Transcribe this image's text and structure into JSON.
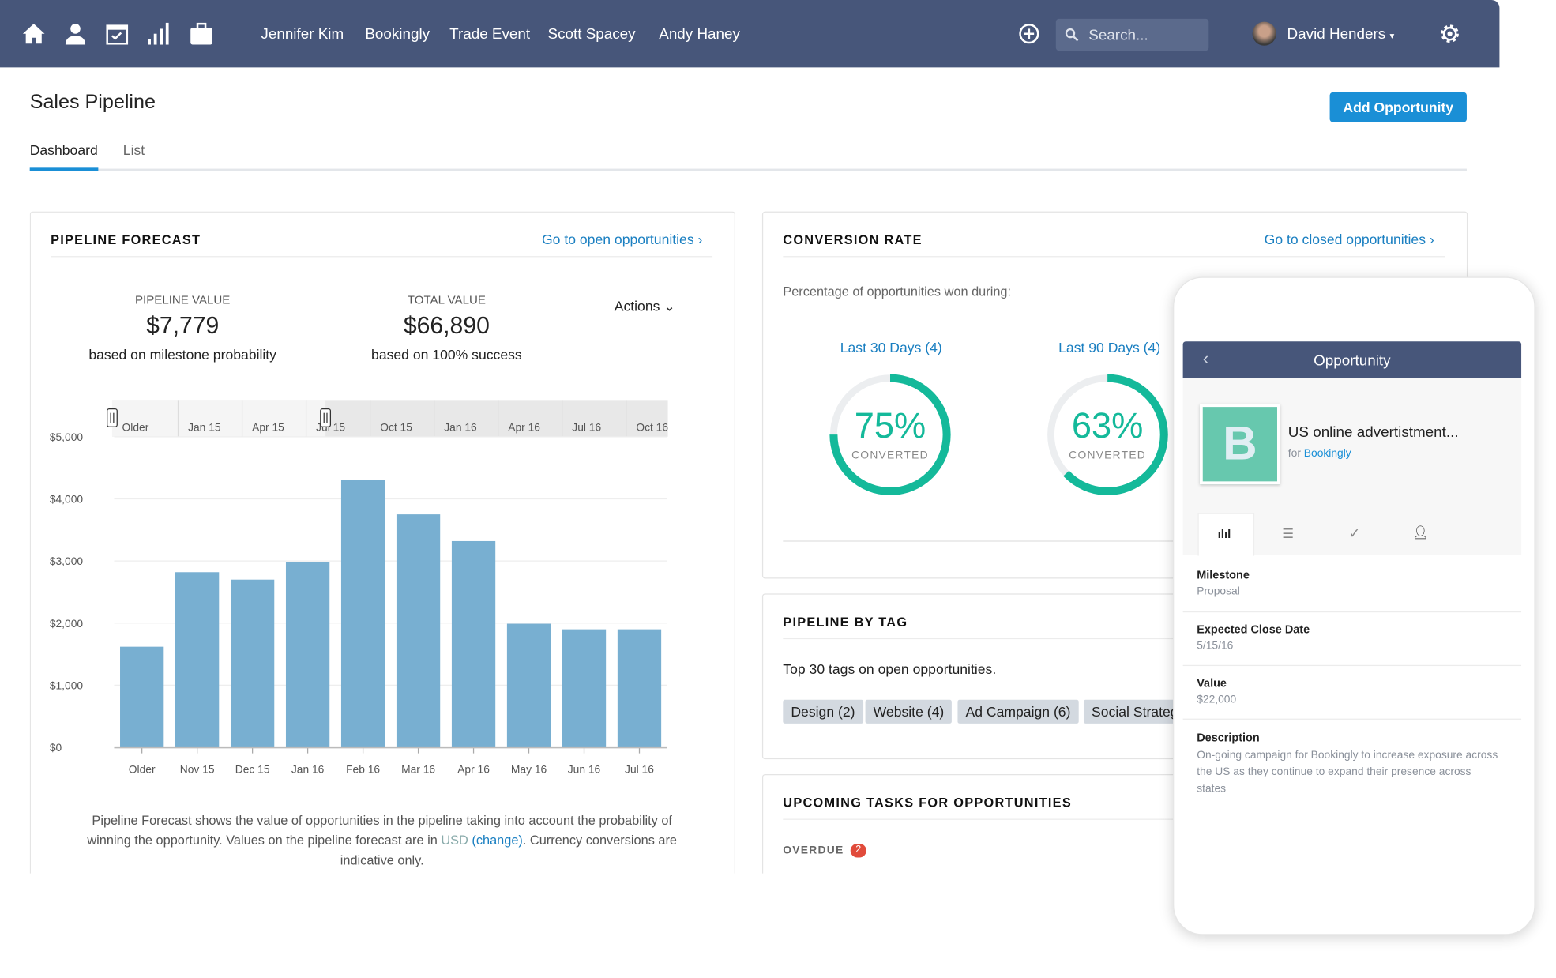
{
  "nav": {
    "icons": [
      "home-icon",
      "user-icon",
      "calendar-icon",
      "bar-chart-icon",
      "briefcase-icon"
    ],
    "links": [
      "Jennifer Kim",
      "Bookingly",
      "Trade Event",
      "Scott Spacey",
      "Andy Haney"
    ],
    "search_placeholder": "Search...",
    "user": "David Henders",
    "color": "#47567a"
  },
  "page": {
    "title": "Sales Pipeline",
    "add_button": "Add Opportunity",
    "tabs": [
      {
        "label": "Dashboard",
        "active": true
      },
      {
        "label": "List",
        "active": false
      }
    ]
  },
  "forecast": {
    "title": "PIPELINE FORECAST",
    "link": "Go to open opportunities ›",
    "pipeline_label": "PIPELINE VALUE",
    "pipeline_value": "$7,779",
    "pipeline_note": "based on milestone probability",
    "total_label": "TOTAL VALUE",
    "total_value": "$66,890",
    "total_note": "based on 100% success",
    "actions": "Actions",
    "navigator_labels": [
      "Older",
      "Jan 15",
      "Apr 15",
      "Jul 15",
      "Oct 15",
      "Jan 16",
      "Apr 16",
      "Jul 16",
      "Oct 16"
    ],
    "footer_1": "Pipeline Forecast shows the value of opportunities in the pipeline taking into account the probability of winning the opportunity. Values on the pipeline forecast are in ",
    "footer_usd": "USD",
    "footer_change": "(change)",
    "footer_2": ". Currency conversions are indicative only."
  },
  "chart_data": {
    "type": "bar",
    "categories": [
      "Older",
      "Nov 15",
      "Dec 15",
      "Jan 16",
      "Feb 16",
      "Mar 16",
      "Apr 16",
      "May 16",
      "Jun 16",
      "Jul 16"
    ],
    "values": [
      1620,
      2820,
      2700,
      2980,
      4300,
      3750,
      3320,
      1990,
      1900,
      1900
    ],
    "yticks": [
      "$0",
      "$1,000",
      "$2,000",
      "$3,000",
      "$4,000",
      "$5,000"
    ],
    "ylim": [
      0,
      5000
    ],
    "grid": true,
    "color": "#78afd1"
  },
  "conversion": {
    "title": "CONVERSION RATE",
    "link": "Go to closed opportunities ›",
    "subtitle": "Percentage of opportunities won during:",
    "items": [
      {
        "label": "Last 30 Days (4)",
        "percent": "75%",
        "value": 75,
        "caption": "CONVERTED"
      },
      {
        "label": "Last 90 Days (4)",
        "percent": "63%",
        "value": 63,
        "caption": "CONVERTED"
      }
    ],
    "color": "#14b99a"
  },
  "tags": {
    "title": "PIPELINE BY TAG",
    "subtitle": "Top 30 tags on open opportunities.",
    "items": [
      "Design (2)",
      "Website (4)",
      "Ad Campaign (6)",
      "Social Strategy"
    ]
  },
  "tasks": {
    "title": "UPCOMING TASKS FOR OPPORTUNITIES",
    "overdue": "OVERDUE",
    "overdue_count": "2"
  },
  "mobile": {
    "header": "Opportunity",
    "avatar_letter": "B",
    "name": "US online advertistment...",
    "for": "for",
    "company": "Bookingly",
    "tab_icons": [
      "bar-chart-icon",
      "list-icon",
      "check-icon",
      "person-icon"
    ],
    "fields": [
      {
        "label": "Milestone",
        "value": "Proposal"
      },
      {
        "label": "Expected Close Date",
        "value": "5/15/16"
      },
      {
        "label": "Value",
        "value": "$22,000"
      },
      {
        "label": "Description",
        "value": "On-going campaign for Bookingly to increase exposure across the US as they continue to expand their presence across states"
      }
    ]
  }
}
